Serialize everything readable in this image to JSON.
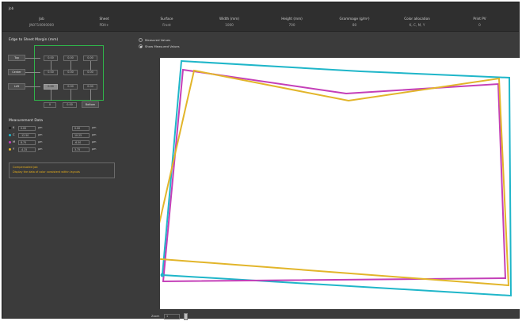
{
  "job": {
    "label": "Job",
    "columns": [
      {
        "header": "Job",
        "value": "JN0710000000"
      },
      {
        "header": "Sheet",
        "value": "PDA+"
      },
      {
        "header": "Surface",
        "value": "Front"
      },
      {
        "header": "Width (mm)",
        "value": "1000"
      },
      {
        "header": "Height (mm)",
        "value": "700"
      },
      {
        "header": "Grammage (g/m²)",
        "value": "80"
      },
      {
        "header": "Color allocation",
        "value": "K, C, M, Y"
      },
      {
        "header": "Print PV",
        "value": "0"
      }
    ]
  },
  "edge_panel": {
    "title": "Edge to Sheet Margin (mm)",
    "buttons": {
      "top": "Top",
      "center": "Center",
      "left": "Left",
      "bottom": "Bottom"
    },
    "grid_values": [
      [
        "0.00",
        "0.00",
        "0.00"
      ],
      [
        "0.00",
        "0.00",
        "0.00"
      ],
      [
        "0.00",
        "0.00",
        "0.00"
      ]
    ],
    "bottom_values": [
      "0",
      "0.00",
      "0.00"
    ]
  },
  "measurement": {
    "title": "Measurement Data",
    "unit": "µm",
    "rows": [
      {
        "letter": "K",
        "color": "#1a1a1a",
        "v1": "0.00",
        "v2": "0.00"
      },
      {
        "letter": "C",
        "color": "#1fb6c9",
        "v1": "-12.50",
        "v2": "10.25"
      },
      {
        "letter": "M",
        "color": "#c43fb8",
        "v1": "8.75",
        "v2": "-6.50"
      },
      {
        "letter": "Y",
        "color": "#e2b52a",
        "v1": "-4.25",
        "v2": "3.75"
      }
    ]
  },
  "warning": {
    "title": "Compensated job",
    "text": "Display the data of color consistent within layouts"
  },
  "view_options": {
    "measured": "Measured Values",
    "show_measured": "Show Measured Values",
    "selected": "show_measured"
  },
  "zoom": {
    "label": "Zoom",
    "value": "1"
  },
  "plot": {
    "outlines": [
      {
        "name": "C",
        "color": "#1fb6c9",
        "points": [
          [
            27,
            4
          ],
          [
            253,
            17
          ],
          [
            441,
            25
          ],
          [
            443,
            300
          ],
          [
            3,
            274
          ]
        ]
      },
      {
        "name": "M",
        "color": "#c43fb8",
        "points": [
          [
            29,
            15
          ],
          [
            235,
            45
          ],
          [
            427,
            33
          ],
          [
            436,
            278
          ],
          [
            4,
            282
          ]
        ]
      },
      {
        "name": "Y",
        "color": "#e2b52a",
        "points": [
          [
            43,
            16
          ],
          [
            238,
            54
          ],
          [
            428,
            26
          ],
          [
            440,
            287
          ],
          [
            -11,
            253
          ]
        ]
      }
    ]
  }
}
